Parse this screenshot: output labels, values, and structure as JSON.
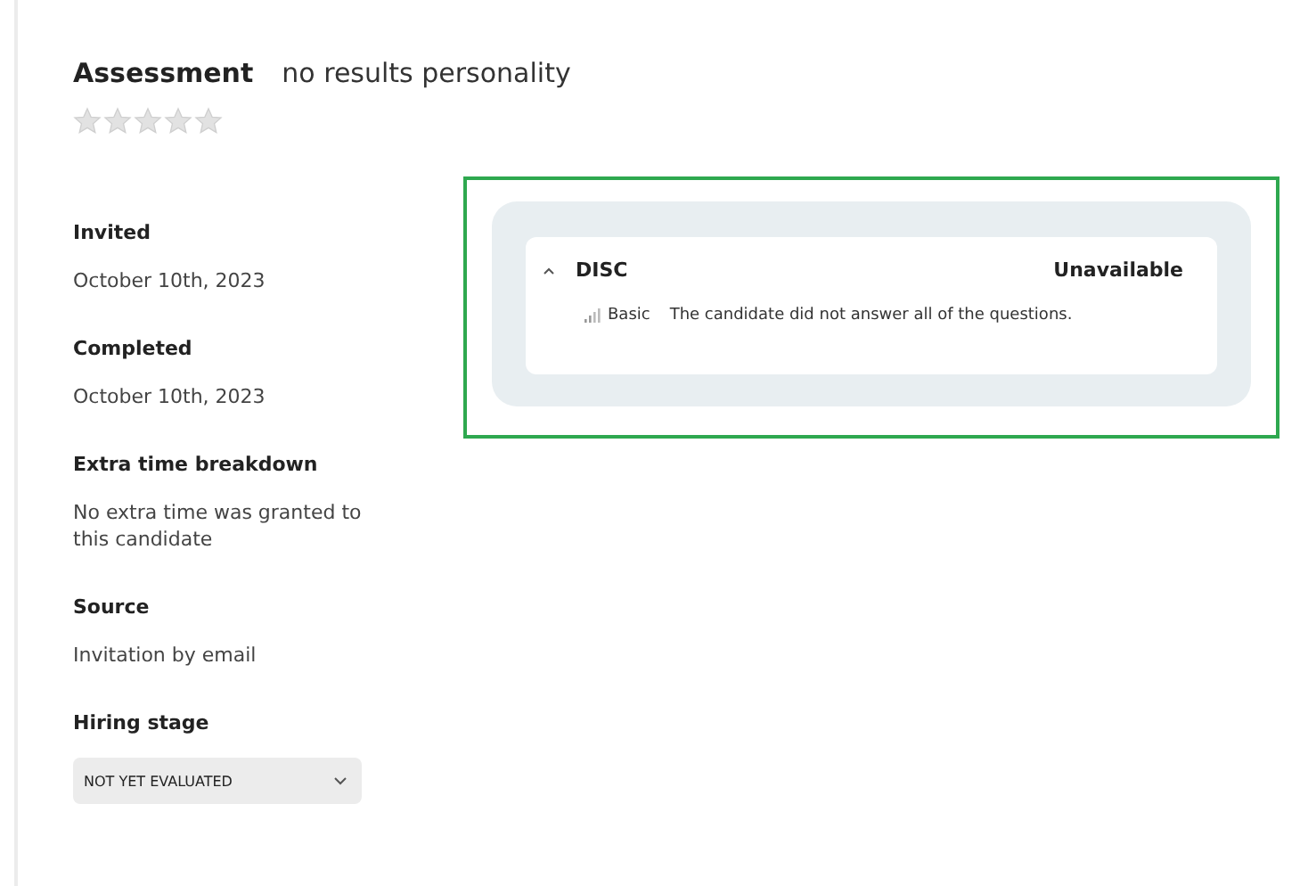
{
  "header": {
    "label": "Assessment",
    "name": "no results personality",
    "stars": 0
  },
  "details": [
    {
      "label": "Invited",
      "value": "October 10th, 2023"
    },
    {
      "label": "Completed",
      "value": "October 10th, 2023"
    },
    {
      "label": "Extra time breakdown",
      "value": "No extra time was granted to this candidate"
    },
    {
      "label": "Source",
      "value": "Invitation by email"
    }
  ],
  "hiring_stage": {
    "label": "Hiring stage",
    "value": "NOT YET EVALUATED"
  },
  "results": [
    {
      "title": "DISC",
      "expanded": true,
      "status": "Unavailable",
      "level": "Basic",
      "message": "The candidate did not answer all of the questions."
    }
  ]
}
